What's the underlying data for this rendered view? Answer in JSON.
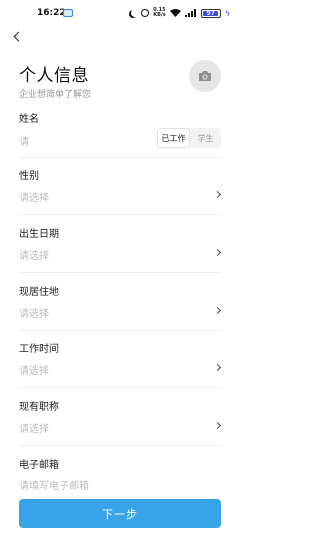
{
  "status_bar": {
    "time": "16:22",
    "speed": "0.15\nKB/s",
    "battery": "97"
  },
  "header": {
    "title": "个人信息",
    "subtitle": "企业想简单了解您"
  },
  "form": {
    "name": {
      "label": "姓名",
      "placeholder": "请",
      "toggle": [
        "已工作",
        "学生"
      ],
      "toggle_selected": "已工作"
    },
    "gender": {
      "label": "性别",
      "placeholder": "请选择"
    },
    "birthday": {
      "label": "出生日期",
      "placeholder": "请选择"
    },
    "residence": {
      "label": "现居住地",
      "placeholder": "请选择"
    },
    "work_time": {
      "label": "工作时间",
      "placeholder": "请选择"
    },
    "title": {
      "label": "现有职称",
      "placeholder": "请选择"
    },
    "email": {
      "label": "电子邮箱",
      "placeholder": "请填写电子邮箱"
    }
  },
  "next_button": "下一步",
  "colors": {
    "accent": "#38a4e8",
    "placeholder": "#bbbbbb",
    "divider": "#eeeeee"
  }
}
